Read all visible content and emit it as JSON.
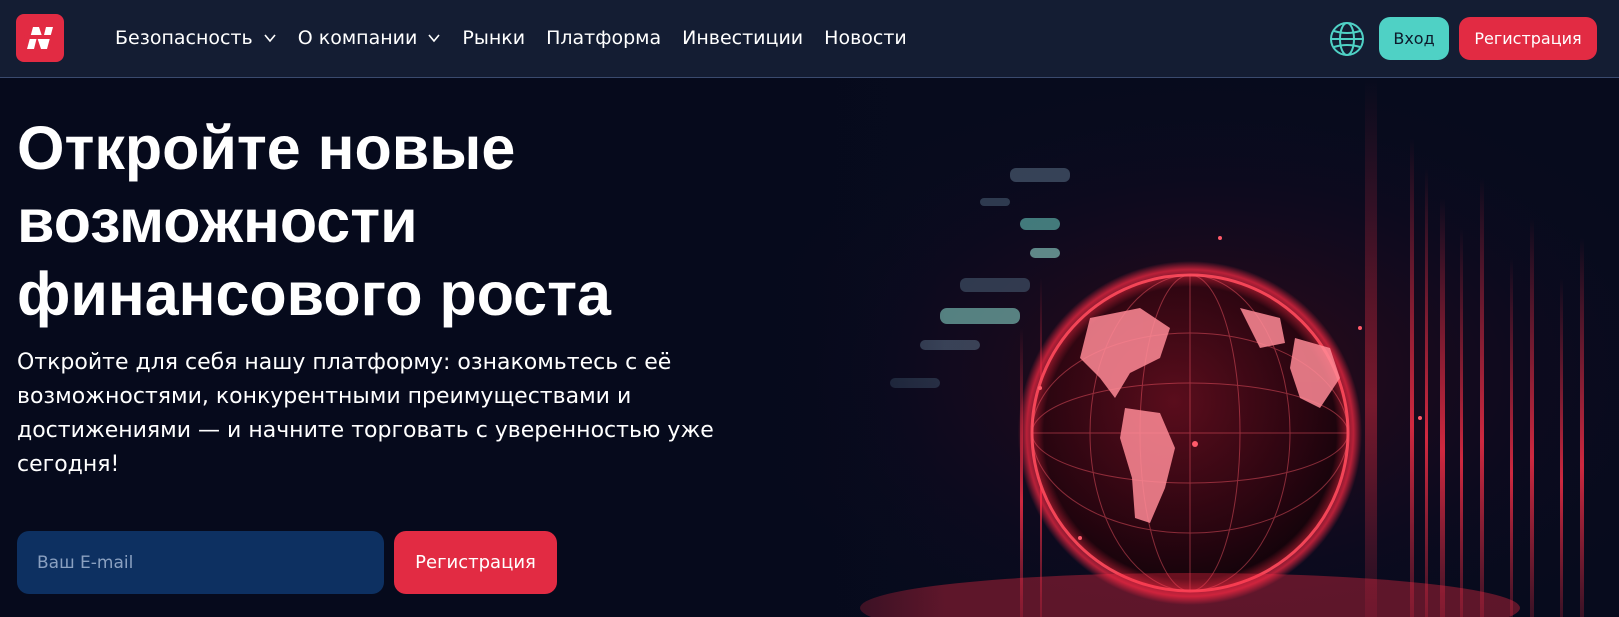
{
  "header": {
    "logo_icon": "brand-n-logo",
    "nav": [
      {
        "label": "Безопасность",
        "has_dropdown": true
      },
      {
        "label": "О компании",
        "has_dropdown": true
      },
      {
        "label": "Рынки",
        "has_dropdown": false
      },
      {
        "label": "Платформа",
        "has_dropdown": false
      },
      {
        "label": "Инвестиции",
        "has_dropdown": false
      },
      {
        "label": "Новости",
        "has_dropdown": false
      }
    ],
    "language_icon": "globe-icon",
    "login_label": "Вход",
    "register_label": "Регистрация"
  },
  "hero": {
    "title": "Откройте новые возможности финансового роста",
    "subtitle": "Откройте для себя нашу платформу: ознакомьтесь с её возможностями, конкурентными преимуществами и достижениями — и начните торговать с уверенностью уже сегодня!",
    "email_placeholder": "Ваш E-mail",
    "register_label": "Регистрация",
    "image": "glowing-red-globe"
  },
  "colors": {
    "background": "#060a1c",
    "header_bg": "#141d33",
    "accent_red": "#e22b43",
    "accent_teal": "#4fd1c5",
    "input_bg": "#0d3061"
  }
}
